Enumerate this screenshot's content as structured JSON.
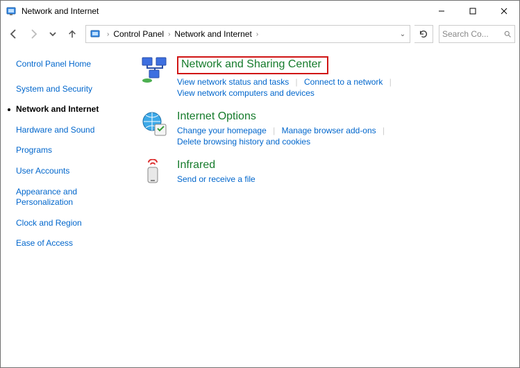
{
  "window": {
    "title": "Network and Internet"
  },
  "breadcrumbs": {
    "root": "Control Panel",
    "sub": "Network and Internet"
  },
  "search": {
    "placeholder": "Search Co..."
  },
  "sidebar": {
    "home": "Control Panel Home",
    "items": [
      "System and Security",
      "Network and Internet",
      "Hardware and Sound",
      "Programs",
      "User Accounts",
      "Appearance and Personalization",
      "Clock and Region",
      "Ease of Access"
    ],
    "activeIndex": 1
  },
  "categories": {
    "network": {
      "title": "Network and Sharing Center",
      "link1": "View network status and tasks",
      "link2": "Connect to a network",
      "link3": "View network computers and devices"
    },
    "internet": {
      "title": "Internet Options",
      "link1": "Change your homepage",
      "link2": "Manage browser add-ons",
      "link3": "Delete browsing history and cookies"
    },
    "infrared": {
      "title": "Infrared",
      "link1": "Send or receive a file"
    }
  }
}
